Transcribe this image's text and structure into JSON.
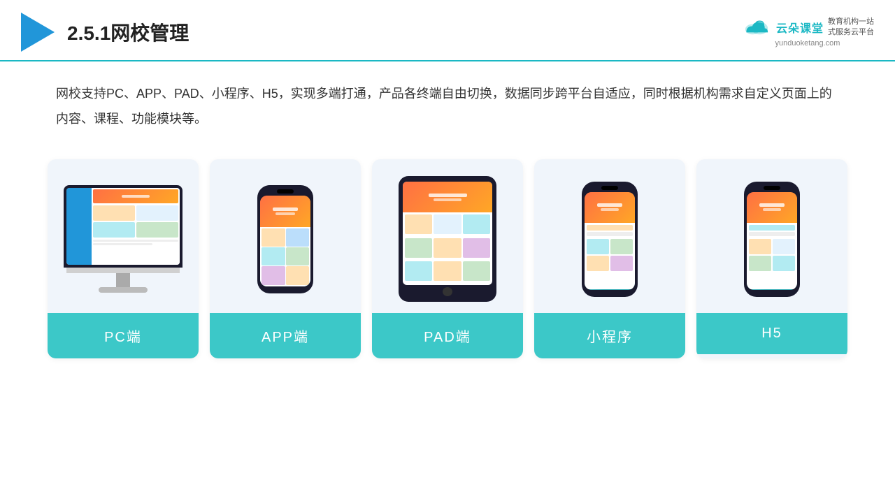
{
  "header": {
    "title": "2.5.1网校管理",
    "brand": {
      "name": "云朵课堂",
      "url": "yunduoketang.com",
      "slogan": "教育机构一站\n式服务云平台"
    }
  },
  "description": {
    "text": "网校支持PC、APP、PAD、小程序、H5，实现多端打通，产品各终端自由切换，数据同步跨平台自适应，同时根据机构需求自定义页面上的内容、课程、功能模块等。"
  },
  "cards": [
    {
      "id": "pc",
      "label": "PC端"
    },
    {
      "id": "app",
      "label": "APP端"
    },
    {
      "id": "pad",
      "label": "PAD端"
    },
    {
      "id": "miniprogram",
      "label": "小程序"
    },
    {
      "id": "h5",
      "label": "H5"
    }
  ],
  "colors": {
    "accent": "#1bb8c4",
    "card_bg": "#f0f5fb",
    "card_label_bg": "#3cc8c8",
    "title_color": "#222",
    "text_color": "#333",
    "header_border": "#1bb8c4"
  }
}
